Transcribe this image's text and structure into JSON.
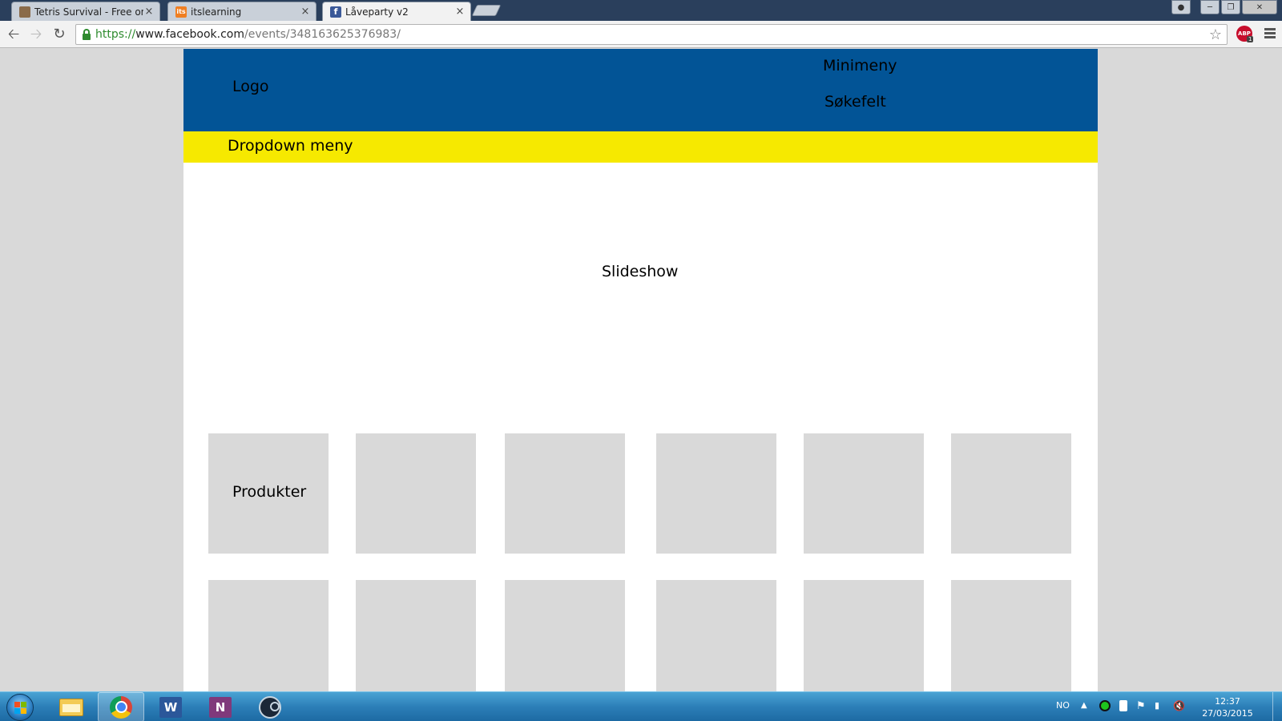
{
  "browser": {
    "tabs": [
      {
        "title": "Tetris Survival - Free onlin",
        "favicon": "tetris-favicon",
        "close": "×"
      },
      {
        "title": "itslearning",
        "favicon": "itslearning-favicon",
        "favicon_text": "its",
        "close": "×"
      },
      {
        "title": "Låveparty v2",
        "favicon": "facebook-favicon",
        "favicon_text": "f",
        "close": "×"
      }
    ],
    "address": {
      "scheme": "https://",
      "host": "www.facebook.com",
      "path": "/events/348163625376983/"
    },
    "extension_badge": "ABP",
    "extension_count": "1"
  },
  "mockup": {
    "logo": "Logo",
    "minimeny": "Minimeny",
    "sokefelt": "Søkefelt",
    "dropdown": "Dropdown meny",
    "slideshow": "Slideshow",
    "product_label": "Produkter",
    "colors": {
      "header": "#025496",
      "dropdown": "#f6e900",
      "tile": "#d9d9d9"
    }
  },
  "taskbar": {
    "language": "NO",
    "time": "12:37",
    "date": "27/03/2015",
    "apps": [
      "windows-explorer-icon",
      "chrome-icon",
      "word-icon",
      "onenote-icon",
      "steam-icon"
    ]
  }
}
